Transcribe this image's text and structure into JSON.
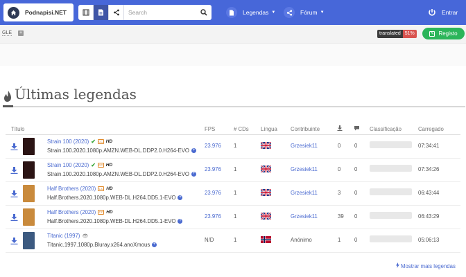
{
  "navbar": {
    "brand": "Podnapisi.NET",
    "search_placeholder": "Search",
    "menu_legendas": "Legendas",
    "menu_forum": "Fórum",
    "menu_entrar": "Entrar"
  },
  "subbar": {
    "language_code": "GLE",
    "translated_label": "translated",
    "translated_percent": "51%",
    "register_label": "Registo"
  },
  "page": {
    "title": "Últimas legendas",
    "show_more": "Mostrar mais legendas"
  },
  "table": {
    "headers": {
      "title": "Título",
      "fps": "FPS",
      "cds": "# CDs",
      "language": "Língua",
      "contributor": "Contribuinte",
      "rating": "Classificação",
      "uploaded": "Carregado"
    },
    "rows": [
      {
        "title": "Strain 100 (2020)",
        "release": "Strain.100.2020.1080p.AMZN.WEB-DL.DDP2.0.H264-EVO",
        "fps": "23.976",
        "cds": "1",
        "language_flag": "uk-flag",
        "contributor": "Grzesiek11",
        "downloads": "0",
        "comments": "0",
        "uploaded": "07:34:41",
        "poster_color": "#2b1414"
      },
      {
        "title": "Strain 100 (2020)",
        "release": "Strain.100.2020.1080p.AMZN.WEB-DL.DDP2.0.H264-EVO",
        "fps": "23.976",
        "cds": "1",
        "language_flag": "uk-flag",
        "contributor": "Grzesiek11",
        "downloads": "0",
        "comments": "0",
        "uploaded": "07:34:26",
        "poster_color": "#2b1414"
      },
      {
        "title": "Half Brothers (2020)",
        "release": "Half.Brothers.2020.1080p.WEB-DL.H264.DD5.1-EVO",
        "fps": "23.976",
        "cds": "1",
        "language_flag": "uk-flag",
        "contributor": "Grzesiek11",
        "downloads": "3",
        "comments": "0",
        "uploaded": "06:43:44",
        "poster_color": "#c98a3c"
      },
      {
        "title": "Half Brothers (2020)",
        "release": "Half.Brothers.2020.1080p.WEB-DL.H264.DD5.1-EVO",
        "fps": "23.976",
        "cds": "1",
        "language_flag": "uk-flag",
        "contributor": "Grzesiek11",
        "downloads": "39",
        "comments": "0",
        "uploaded": "06:43:29",
        "poster_color": "#c98a3c"
      },
      {
        "title": "Titanic (1997)",
        "release": "Titanic.1997.1080p.Bluray.x264.anoXmous",
        "fps": "N/D",
        "cds": "1",
        "language_flag": "norway-flag",
        "contributor": "Anónimo",
        "downloads": "1",
        "comments": "0",
        "uploaded": "05:06:13",
        "poster_color": "#3c5a80"
      }
    ]
  },
  "colors": {
    "navbar": "#4767d9",
    "link": "#4a6ad0",
    "register": "#2cb55a",
    "translated_percent_bg": "#d9534f"
  }
}
